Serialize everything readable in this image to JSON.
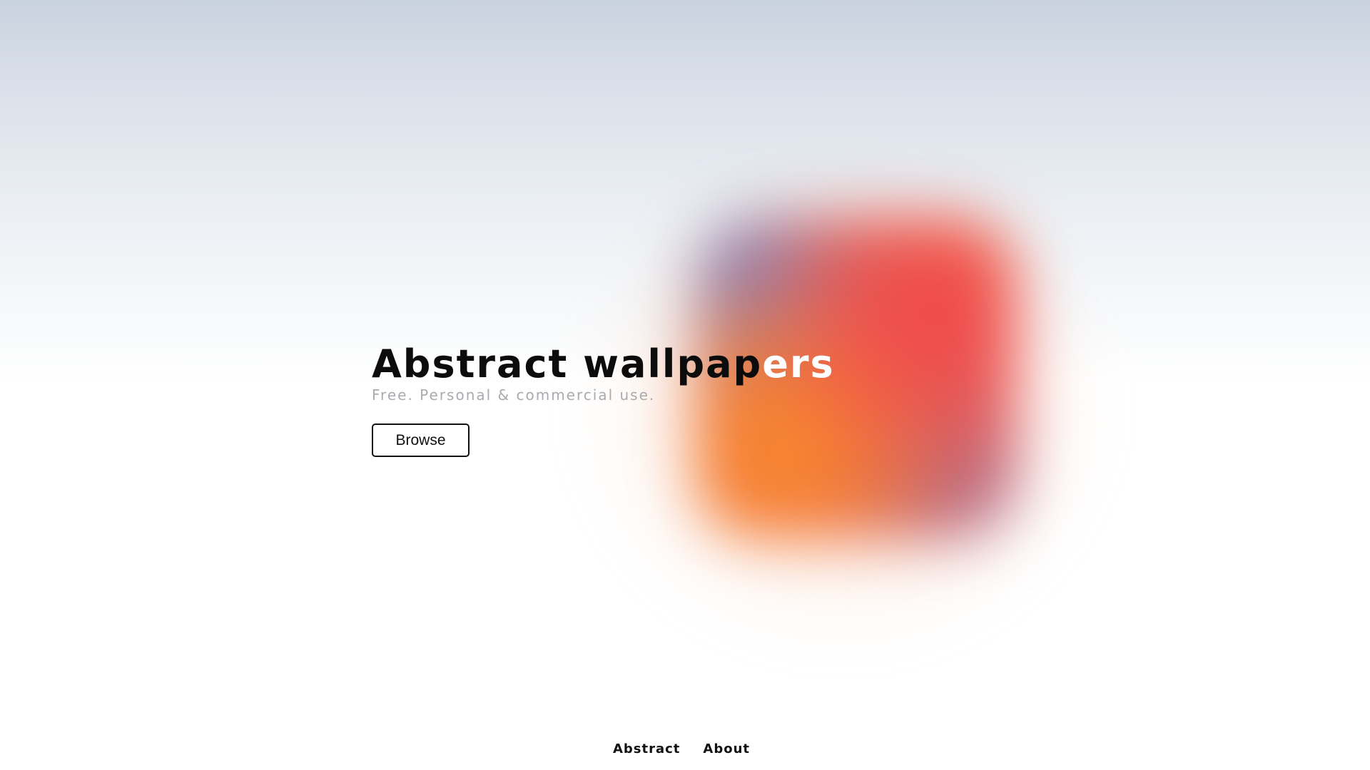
{
  "hero": {
    "title_dark": "Abstract wallpap",
    "title_light": "ers",
    "subtitle": "Free. Personal & commercial use.",
    "browse_label": "Browse"
  },
  "footer": {
    "links": [
      {
        "label": "Abstract"
      },
      {
        "label": "About"
      }
    ]
  },
  "colors": {
    "blob_red": "#ef4651",
    "blob_orange": "#f88a2e",
    "background_top": "#c9d2df",
    "background_bottom": "#ffffff"
  }
}
